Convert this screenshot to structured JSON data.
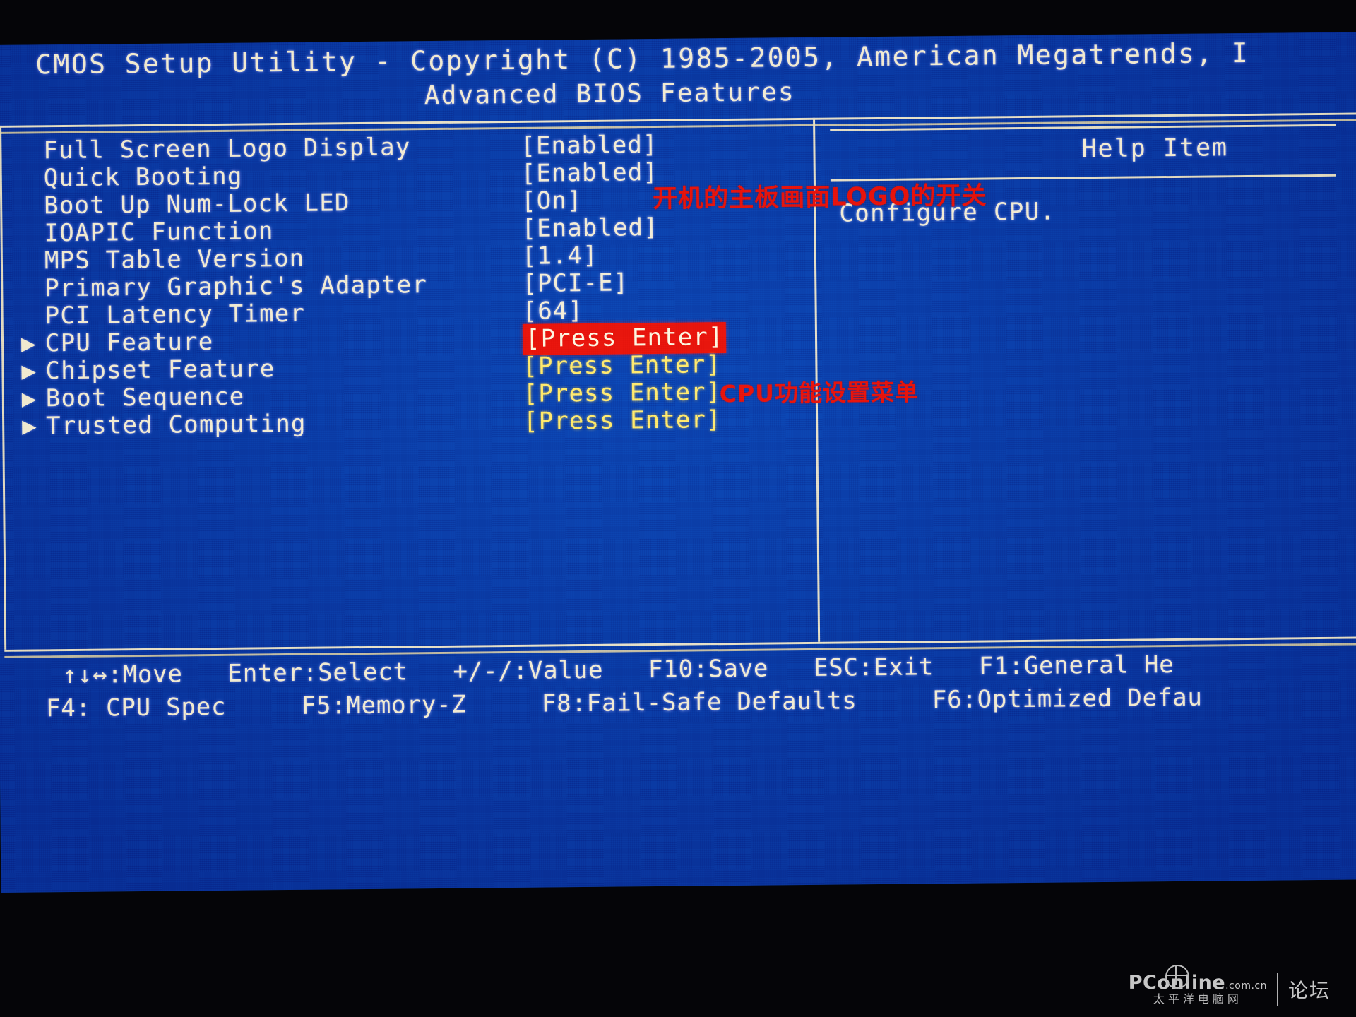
{
  "header": {
    "title": "CMOS Setup Utility - Copyright (C) 1985-2005, American Megatrends, I",
    "subtitle": "Advanced BIOS Features"
  },
  "settings": [
    {
      "arrow": "",
      "label": "Full Screen Logo Display",
      "value": "[Enabled]",
      "style": "plain"
    },
    {
      "arrow": "",
      "label": "Quick Booting",
      "value": "[Enabled]",
      "style": "plain"
    },
    {
      "arrow": "",
      "label": "Boot Up Num-Lock LED",
      "value": "[On]",
      "style": "plain"
    },
    {
      "arrow": "",
      "label": "IOAPIC Function",
      "value": "[Enabled]",
      "style": "plain"
    },
    {
      "arrow": "",
      "label": "MPS Table Version",
      "value": "[1.4]",
      "style": "plain"
    },
    {
      "arrow": "",
      "label": "Primary Graphic's Adapter",
      "value": "[PCI-E]",
      "style": "plain"
    },
    {
      "arrow": "",
      "label": "PCI Latency Timer",
      "value": "[64]",
      "style": "plain"
    },
    {
      "arrow": "▶",
      "label": "CPU Feature",
      "value": "[Press Enter]",
      "style": "highlighted"
    },
    {
      "arrow": "▶",
      "label": "Chipset Feature",
      "value": "[Press Enter]",
      "style": "enter"
    },
    {
      "arrow": "▶",
      "label": "Boot Sequence",
      "value": "[Press Enter]",
      "style": "enter"
    },
    {
      "arrow": "▶",
      "label": "Trusted Computing",
      "value": "[Press Enter]",
      "style": "enter"
    }
  ],
  "help": {
    "title": "Help Item",
    "body": "Configure CPU."
  },
  "annotations": [
    {
      "name": "full-screen-logo-note",
      "text": "开机的主板画面LOGO的开关"
    },
    {
      "name": "cpu-feature-note",
      "text": "CPU功能设置菜单"
    }
  ],
  "footer": {
    "line1": "↑↓↔:Move   Enter:Select   +/-/:Value   F10:Save   ESC:Exit   F1:General He",
    "line2": "F4: CPU Spec     F5:Memory-Z     F8:Fail-Safe Defaults     F6:Optimized Defau"
  },
  "watermark": {
    "brand": "PConline",
    "brand_suffix": ".com.cn",
    "brand_cn": "太平洋电脑网",
    "section": "论坛"
  },
  "colors": {
    "screen_blue": "#0b41ad",
    "text_cream": "#f3edd8",
    "value_yellow": "#ffe96a",
    "highlight_red": "#e8140c"
  }
}
